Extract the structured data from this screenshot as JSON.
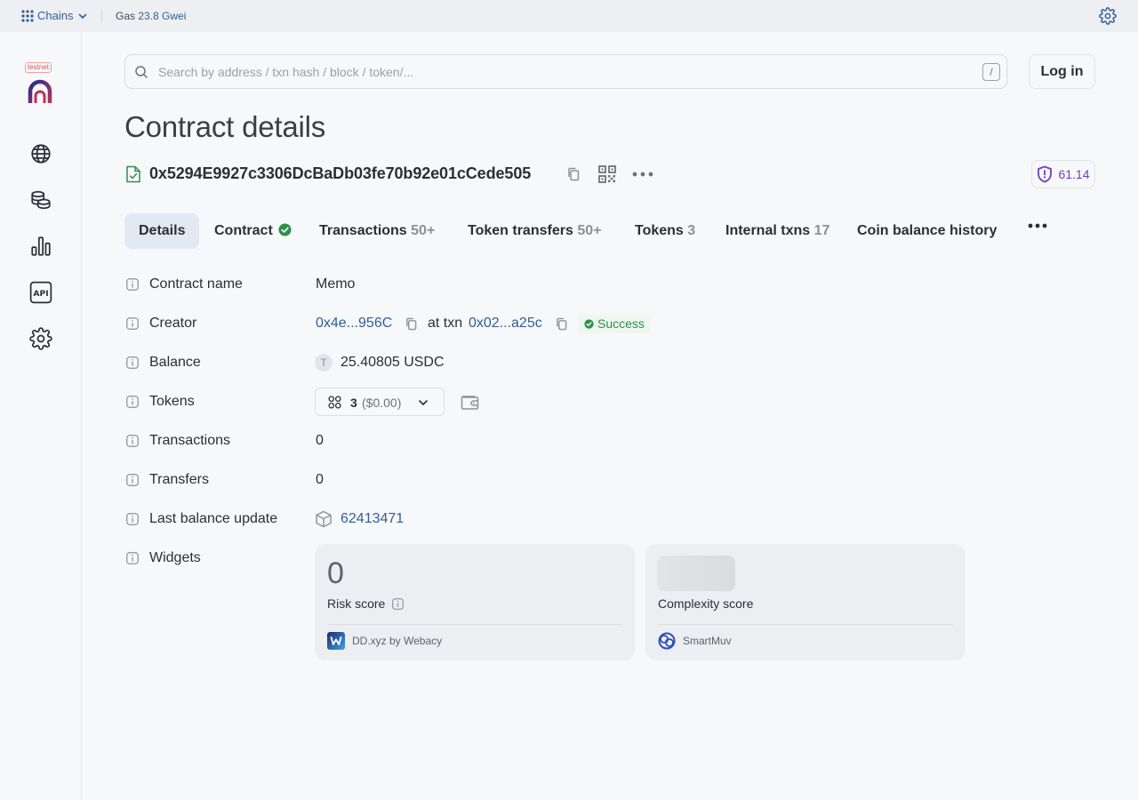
{
  "topbar": {
    "chains_label": "Chains",
    "gas_label": "Gas",
    "gas_value": "23.8 Gwei"
  },
  "sidebar": {
    "badge": "testnet",
    "items": [
      "globe-icon",
      "coins-icon",
      "stats-icon",
      "api-icon",
      "gear-icon"
    ]
  },
  "search": {
    "placeholder": "Search by address / txn hash / block / token/...",
    "shortcut": "/"
  },
  "login_label": "Log in",
  "page_title": "Contract details",
  "address": {
    "hash": "0x5294E9927c3306DcBaDb03fe70b92e01cCede505",
    "score": "61.14"
  },
  "tabs": [
    {
      "label": "Details",
      "count": ""
    },
    {
      "label": "Contract",
      "count": ""
    },
    {
      "label": "Transactions",
      "count": "50+"
    },
    {
      "label": "Token transfers",
      "count": "50+"
    },
    {
      "label": "Tokens",
      "count": "3"
    },
    {
      "label": "Internal txns",
      "count": "17"
    },
    {
      "label": "Coin balance history",
      "count": ""
    }
  ],
  "details": {
    "contract_name": {
      "label": "Contract name",
      "value": "Memo"
    },
    "creator": {
      "label": "Creator",
      "address": "0x4e...956C",
      "at_txn": "at txn",
      "txn": "0x02...a25c",
      "status": "Success"
    },
    "balance": {
      "label": "Balance",
      "token_icon_letter": "T",
      "value": "25.40805",
      "unit": "USDC"
    },
    "tokens": {
      "label": "Tokens",
      "count": "3",
      "usd": "($0.00)"
    },
    "transactions": {
      "label": "Transactions",
      "value": "0"
    },
    "transfers": {
      "label": "Transfers",
      "value": "0"
    },
    "last_balance_update": {
      "label": "Last balance update",
      "value": "62413471"
    },
    "widgets": {
      "label": "Widgets"
    }
  },
  "widgets": [
    {
      "score": "0",
      "label": "Risk score",
      "source": "DD.xyz by Webacy"
    },
    {
      "score": "",
      "label": "Complexity score",
      "source": "SmartMuv"
    }
  ],
  "colors": {
    "link": "#2f5f96",
    "success": "#2f8f4a",
    "score": "#6f3fbf",
    "active_tab_bg": "#e3e8f2"
  }
}
